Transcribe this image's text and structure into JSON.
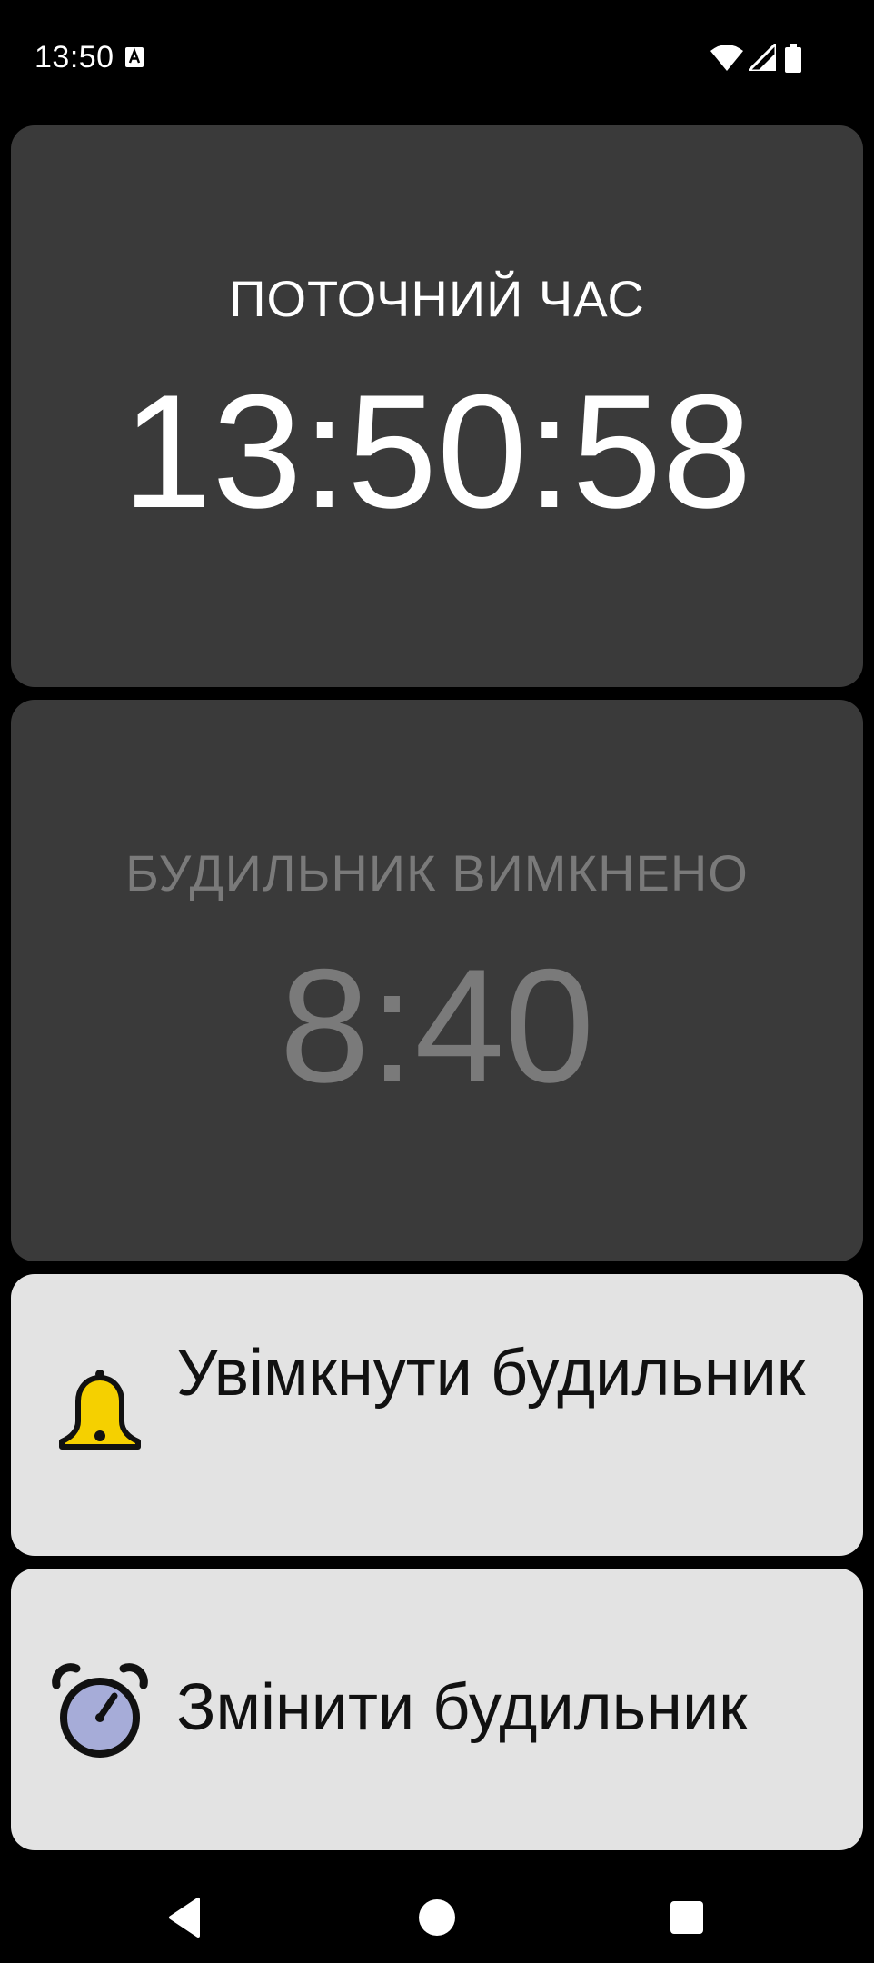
{
  "status_bar": {
    "time": "13:50",
    "left_icon": "keyboard-a-icon",
    "right_icons": [
      "wifi-icon",
      "signal-icon",
      "battery-icon"
    ]
  },
  "clock_card": {
    "label": "ПОТОЧНИЙ ЧАС",
    "time": "13:50:58"
  },
  "alarm_card": {
    "label": "БУДИЛЬНИК ВИМКНЕНО",
    "time": "8:40"
  },
  "actions": {
    "enable": {
      "label": "Увімкнути будильник",
      "icon": "bell-icon",
      "icon_color": "#f5d000"
    },
    "change": {
      "label": "Змінити будильник",
      "icon": "alarm-clock-icon",
      "icon_color": "#a6acd8"
    }
  },
  "nav": {
    "back": "back-icon",
    "home": "home-icon",
    "recents": "recents-icon"
  },
  "colors": {
    "background": "#000000",
    "card_dark": "#3a3a3a",
    "card_light": "#e3e3e3",
    "disabled_text": "#7a7a7a"
  }
}
